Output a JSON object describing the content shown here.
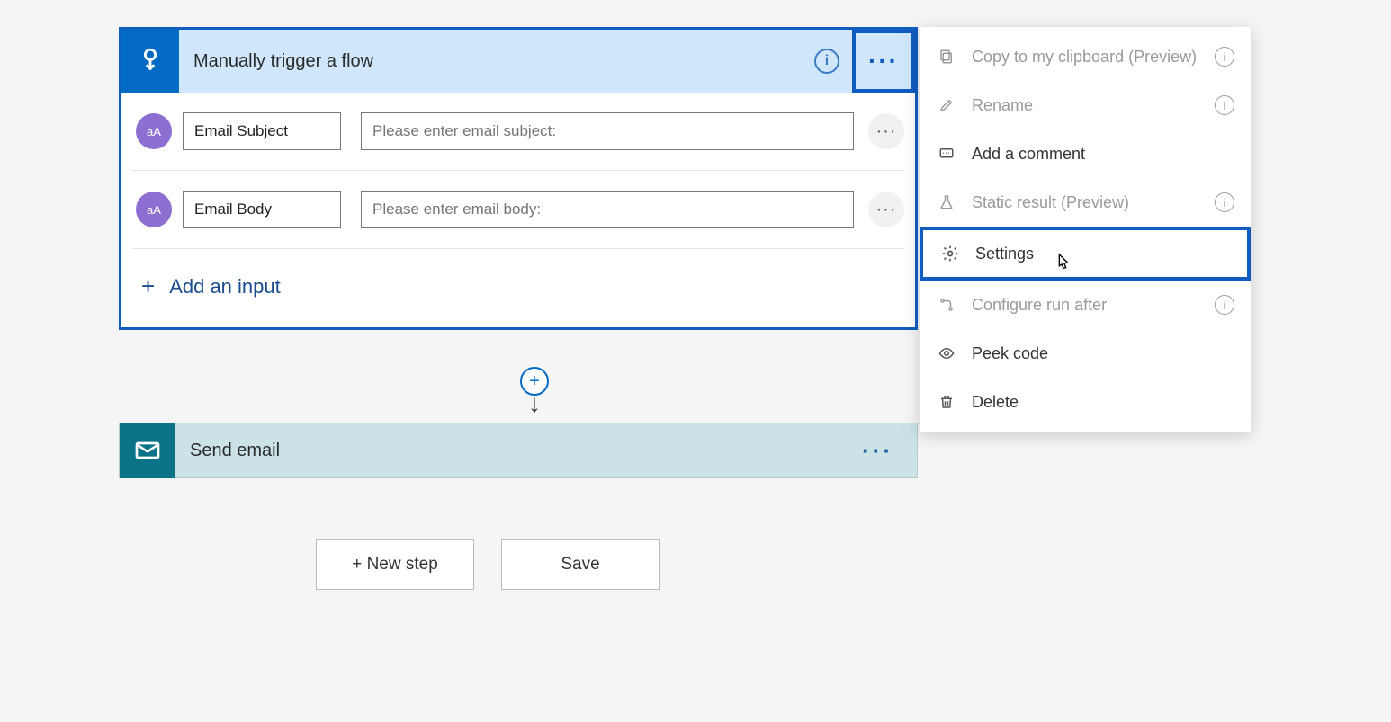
{
  "trigger": {
    "title": "Manually trigger a flow",
    "inputs": [
      {
        "name": "Email Subject",
        "placeholder": "Please enter email subject:",
        "badge": "aA"
      },
      {
        "name": "Email Body",
        "placeholder": "Please enter email body:",
        "badge": "aA"
      }
    ],
    "add_input_label": "Add an input"
  },
  "action": {
    "title": "Send email"
  },
  "footer": {
    "new_step": "+ New step",
    "save": "Save"
  },
  "menu": {
    "copy": "Copy to my clipboard (Preview)",
    "rename": "Rename",
    "add_comment": "Add a comment",
    "static_result": "Static result (Preview)",
    "settings": "Settings",
    "configure_run_after": "Configure run after",
    "peek_code": "Peek code",
    "delete": "Delete"
  }
}
